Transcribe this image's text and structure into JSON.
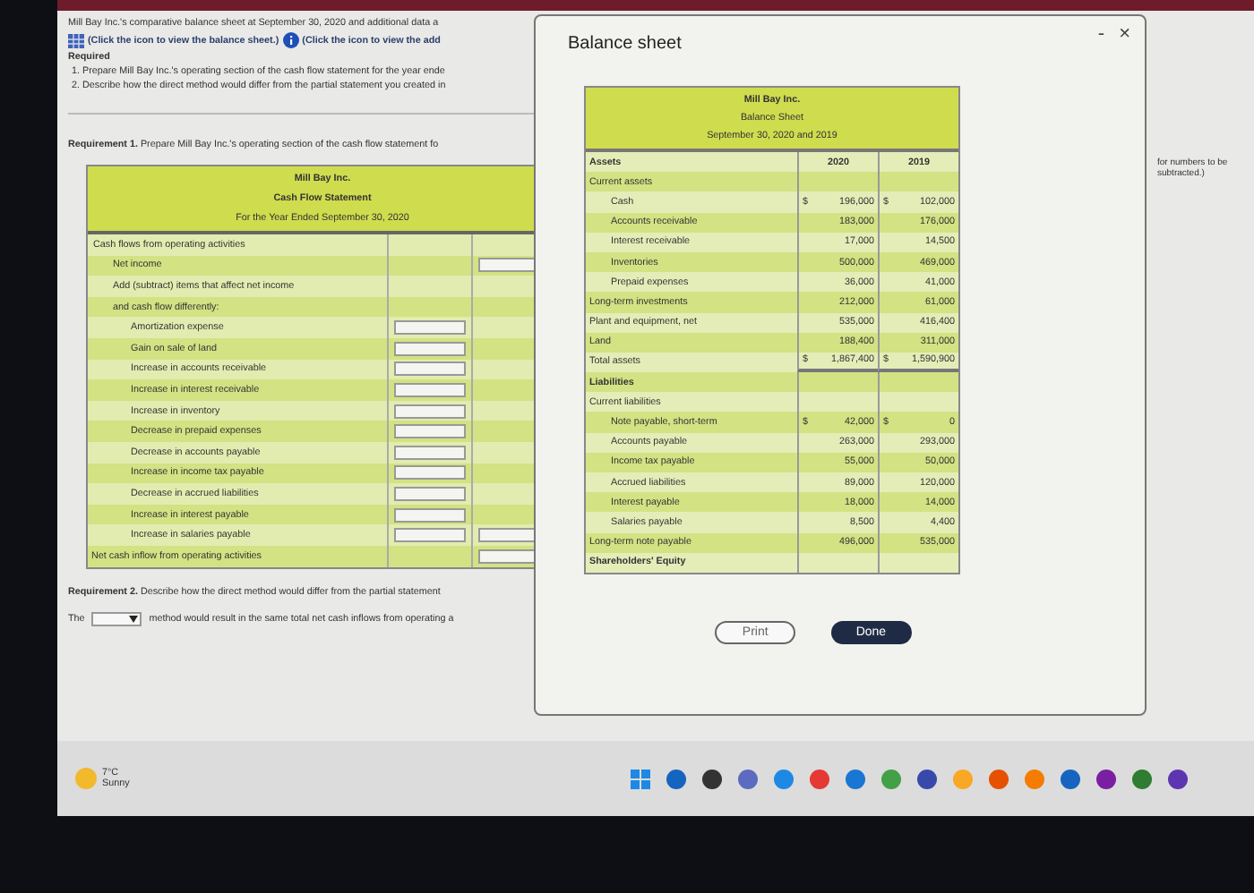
{
  "question": {
    "intro": "Mill Bay Inc.'s comparative balance sheet at September 30, 2020 and additional data a",
    "links": [
      {
        "kind": "table",
        "text": "(Click the icon to view the balance sheet.)"
      },
      {
        "kind": "info",
        "text": "(Click the icon to view the add"
      }
    ],
    "required_title": "Required",
    "required_items": [
      "1. Prepare Mill Bay Inc.'s operating section of the cash flow statement for the year ende",
      "2. Describe how the direct method would differ from the partial statement you created in"
    ],
    "requirement_1": "**Requirement 1.** Prepare Mill Bay Inc.'s operating section of the cash flow statement fo",
    "side_note": "for numbers to be subtracted.)"
  },
  "cash_flow": {
    "title_lines": [
      "Mill Bay Inc.",
      "Cash Flow Statement",
      "For the Year Ended September 30, 2020"
    ],
    "rows": [
      {
        "kind": "section",
        "label": "Cash flows from operating activities",
        "input_1": false,
        "input_2": false
      },
      {
        "kind": "item",
        "label": "Net income",
        "input_1": false,
        "input_2": true
      },
      {
        "kind": "item",
        "label": "Add (subtract) items that affect net income",
        "input_1": false,
        "input_2": false
      },
      {
        "kind": "item",
        "label": "and cash flow differently:",
        "input_1": false,
        "input_2": false
      },
      {
        "kind": "detail",
        "label": "Amortization expense",
        "input_1": true,
        "input_2": false
      },
      {
        "kind": "detail",
        "label": "Gain on sale of land",
        "input_1": true,
        "input_2": false
      },
      {
        "kind": "detail",
        "label": "Increase in accounts receivable",
        "input_1": true,
        "input_2": false
      },
      {
        "kind": "detail",
        "label": "Increase in interest receivable",
        "input_1": true,
        "input_2": false
      },
      {
        "kind": "detail",
        "label": "Increase in inventory",
        "input_1": true,
        "input_2": false
      },
      {
        "kind": "detail",
        "label": "Decrease in prepaid expenses",
        "input_1": true,
        "input_2": false
      },
      {
        "kind": "detail",
        "label": "Decrease in accounts payable",
        "input_1": true,
        "input_2": false
      },
      {
        "kind": "detail",
        "label": "Increase in income tax payable",
        "input_1": true,
        "input_2": false
      },
      {
        "kind": "detail",
        "label": "Decrease in accrued liabilities",
        "input_1": true,
        "input_2": false
      },
      {
        "kind": "detail",
        "label": "Increase in interest payable",
        "input_1": true,
        "input_2": false
      },
      {
        "kind": "detail",
        "label": "Increase in salaries payable",
        "input_1": true,
        "input_2": true
      },
      {
        "kind": "total",
        "label": "Net cash inflow from operating activities",
        "input_1": false,
        "input_2": true
      }
    ]
  },
  "requirement_2": {
    "text": "**Requirement 2.** Describe how the direct method would differ from the partial statement",
    "before": "The",
    "after": "method would result in the same total net cash inflows from operating a"
  },
  "modal": {
    "title": "Balance sheet",
    "controls": [
      "-",
      "×"
    ],
    "title_lines": [
      "Mill Bay Inc.",
      "Balance Sheet",
      "September 30, 2020 and 2019"
    ],
    "columns": [
      "Assets",
      "2020",
      "2019"
    ],
    "rows": [
      {
        "kind": "group",
        "label": "Current assets"
      },
      {
        "kind": "item",
        "label": "Cash",
        "cur_1": "$",
        "v_1": "196,000",
        "cur_2": "$",
        "v_2": "102,000"
      },
      {
        "kind": "item",
        "label": "Accounts receivable",
        "v_1": "183,000",
        "v_2": "176,000"
      },
      {
        "kind": "item",
        "label": "Interest receivable",
        "v_1": "17,000",
        "v_2": "14,500"
      },
      {
        "kind": "item",
        "label": "Inventories",
        "v_1": "500,000",
        "v_2": "469,000"
      },
      {
        "kind": "item",
        "label": "Prepaid expenses",
        "v_1": "36,000",
        "v_2": "41,000"
      },
      {
        "kind": "group",
        "label": "Long-term investments",
        "v_1": "212,000",
        "v_2": "61,000"
      },
      {
        "kind": "group",
        "label": "Plant and equipment, net",
        "v_1": "535,000",
        "v_2": "416,400"
      },
      {
        "kind": "group",
        "label": "Land",
        "v_1": "188,400",
        "v_2": "311,000"
      },
      {
        "kind": "total",
        "label": "Total assets",
        "cur_1": "$",
        "v_1": "1,867,400",
        "cur_2": "$",
        "v_2": "1,590,900"
      },
      {
        "kind": "heading",
        "label": "Liabilities"
      },
      {
        "kind": "group",
        "label": "Current liabilities"
      },
      {
        "kind": "item",
        "label": "Note payable, short-term",
        "cur_1": "$",
        "v_1": "42,000",
        "cur_2": "$",
        "v_2": "0"
      },
      {
        "kind": "item",
        "label": "Accounts payable",
        "v_1": "263,000",
        "v_2": "293,000"
      },
      {
        "kind": "item",
        "label": "Income tax payable",
        "v_1": "55,000",
        "v_2": "50,000"
      },
      {
        "kind": "item",
        "label": "Accrued liabilities",
        "v_1": "89,000",
        "v_2": "120,000"
      },
      {
        "kind": "item",
        "label": "Interest payable",
        "v_1": "18,000",
        "v_2": "14,000"
      },
      {
        "kind": "item",
        "label": "Salaries payable",
        "v_1": "8,500",
        "v_2": "4,400"
      },
      {
        "kind": "group",
        "label": "Long-term note payable",
        "v_1": "496,000",
        "v_2": "535,000"
      },
      {
        "kind": "heading",
        "label": "Shareholders' Equity"
      }
    ],
    "buttons": [
      {
        "kind": "secondary",
        "label": "Print"
      },
      {
        "kind": "primary",
        "label": "Done"
      }
    ]
  },
  "taskbar": {
    "weather": {
      "temp": "7°C",
      "condition": "Sunny"
    }
  }
}
